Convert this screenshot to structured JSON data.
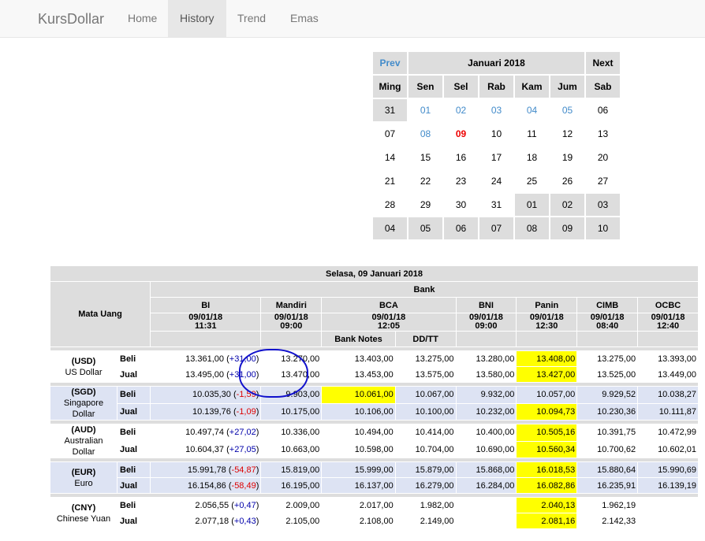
{
  "navbar": {
    "brand": "KursDollar",
    "items": [
      {
        "label": "Home"
      },
      {
        "label": "History"
      },
      {
        "label": "Trend"
      },
      {
        "label": "Emas"
      }
    ]
  },
  "calendar": {
    "prev": "Prev",
    "next": "Next",
    "month": "Januari 2018",
    "weekdays": [
      "Ming",
      "Sen",
      "Sel",
      "Rab",
      "Kam",
      "Jum",
      "Sab"
    ],
    "weeks": [
      [
        "31",
        "01",
        "02",
        "03",
        "04",
        "05",
        "06"
      ],
      [
        "07",
        "08",
        "09",
        "10",
        "11",
        "12",
        "13"
      ],
      [
        "14",
        "15",
        "16",
        "17",
        "18",
        "19",
        "20"
      ],
      [
        "21",
        "22",
        "23",
        "24",
        "25",
        "26",
        "27"
      ],
      [
        "28",
        "29",
        "30",
        "31",
        "01",
        "02",
        "03"
      ],
      [
        "04",
        "05",
        "06",
        "07",
        "08",
        "09",
        "10"
      ]
    ],
    "today": "09"
  },
  "rates": {
    "date_title": "Selasa, 09 Januari 2018",
    "currency_header": "Mata Uang",
    "bank_header": "Bank",
    "banks": [
      {
        "name": "BI",
        "date": "09/01/18",
        "time": "11:31"
      },
      {
        "name": "Mandiri",
        "date": "09/01/18",
        "time": "09:00"
      },
      {
        "name": "BCA",
        "date": "09/01/18",
        "time": "12:05"
      },
      {
        "name": "BNI",
        "date": "09/01/18",
        "time": "09:00"
      },
      {
        "name": "Panin",
        "date": "09/01/18",
        "time": "12:30"
      },
      {
        "name": "CIMB",
        "date": "09/01/18",
        "time": "08:40"
      },
      {
        "name": "OCBC",
        "date": "09/01/18",
        "time": "12:40"
      }
    ],
    "bca_sub": [
      "Bank Notes",
      "DD/TT"
    ],
    "buy_label": "Beli",
    "sell_label": "Jual",
    "currencies": [
      {
        "code": "(USD)",
        "name": "US Dollar",
        "buy": {
          "bi": "13.361,00",
          "bi_change": "+31,00",
          "mandiri": "13.270,00",
          "bca_notes": "13.403,00",
          "bca_tt": "13.275,00",
          "bni": "13.280,00",
          "panin": "13.408,00",
          "cimb": "13.275,00",
          "ocbc": "13.393,00"
        },
        "sell": {
          "bi": "13.495,00",
          "bi_change": "+31,00",
          "mandiri": "13.470,00",
          "bca_notes": "13.453,00",
          "bca_tt": "13.575,00",
          "bni": "13.580,00",
          "panin": "13.427,00",
          "cimb": "13.525,00",
          "ocbc": "13.449,00"
        }
      },
      {
        "code": "(SGD)",
        "name": "Singapore Dollar",
        "buy": {
          "bi": "10.035,30",
          "bi_change": "-1,59",
          "mandiri": "9.903,00",
          "bca_notes": "10.061,00",
          "bca_tt": "10.067,00",
          "bni": "9.932,00",
          "panin": "10.057,00",
          "cimb": "9.929,52",
          "ocbc": "10.038,27"
        },
        "sell": {
          "bi": "10.139,76",
          "bi_change": "-1,09",
          "mandiri": "10.175,00",
          "bca_notes": "10.106,00",
          "bca_tt": "10.100,00",
          "bni": "10.232,00",
          "panin": "10.094,73",
          "cimb": "10.230,36",
          "ocbc": "10.111,87"
        }
      },
      {
        "code": "(AUD)",
        "name": "Australian Dollar",
        "buy": {
          "bi": "10.497,74",
          "bi_change": "+27,02",
          "mandiri": "10.336,00",
          "bca_notes": "10.494,00",
          "bca_tt": "10.414,00",
          "bni": "10.400,00",
          "panin": "10.505,16",
          "cimb": "10.391,75",
          "ocbc": "10.472,99"
        },
        "sell": {
          "bi": "10.604,37",
          "bi_change": "+27,05",
          "mandiri": "10.663,00",
          "bca_notes": "10.598,00",
          "bca_tt": "10.704,00",
          "bni": "10.690,00",
          "panin": "10.560,34",
          "cimb": "10.700,62",
          "ocbc": "10.602,01"
        }
      },
      {
        "code": "(EUR)",
        "name": "Euro",
        "buy": {
          "bi": "15.991,78",
          "bi_change": "-54,87",
          "mandiri": "15.819,00",
          "bca_notes": "15.999,00",
          "bca_tt": "15.879,00",
          "bni": "15.868,00",
          "panin": "16.018,53",
          "cimb": "15.880,64",
          "ocbc": "15.990,69"
        },
        "sell": {
          "bi": "16.154,86",
          "bi_change": "-58,49",
          "mandiri": "16.195,00",
          "bca_notes": "16.137,00",
          "bca_tt": "16.279,00",
          "bni": "16.284,00",
          "panin": "16.082,86",
          "cimb": "16.235,91",
          "ocbc": "16.139,19"
        }
      },
      {
        "code": "(CNY)",
        "name": "Chinese Yuan",
        "buy": {
          "bi": "2.056,55",
          "bi_change": "+0,47",
          "mandiri": "2.009,00",
          "bca_notes": "2.017,00",
          "bca_tt": "1.982,00",
          "bni": "",
          "panin": "2.040,13",
          "cimb": "1.962,19",
          "ocbc": ""
        },
        "sell": {
          "bi": "2.077,18",
          "bi_change": "+0,43",
          "mandiri": "2.105,00",
          "bca_notes": "2.108,00",
          "bca_tt": "2.149,00",
          "bni": "",
          "panin": "2.081,16",
          "cimb": "2.142,33",
          "ocbc": ""
        }
      }
    ],
    "highlight_color": "#ffff00",
    "annotation_color": "#1010cc"
  }
}
